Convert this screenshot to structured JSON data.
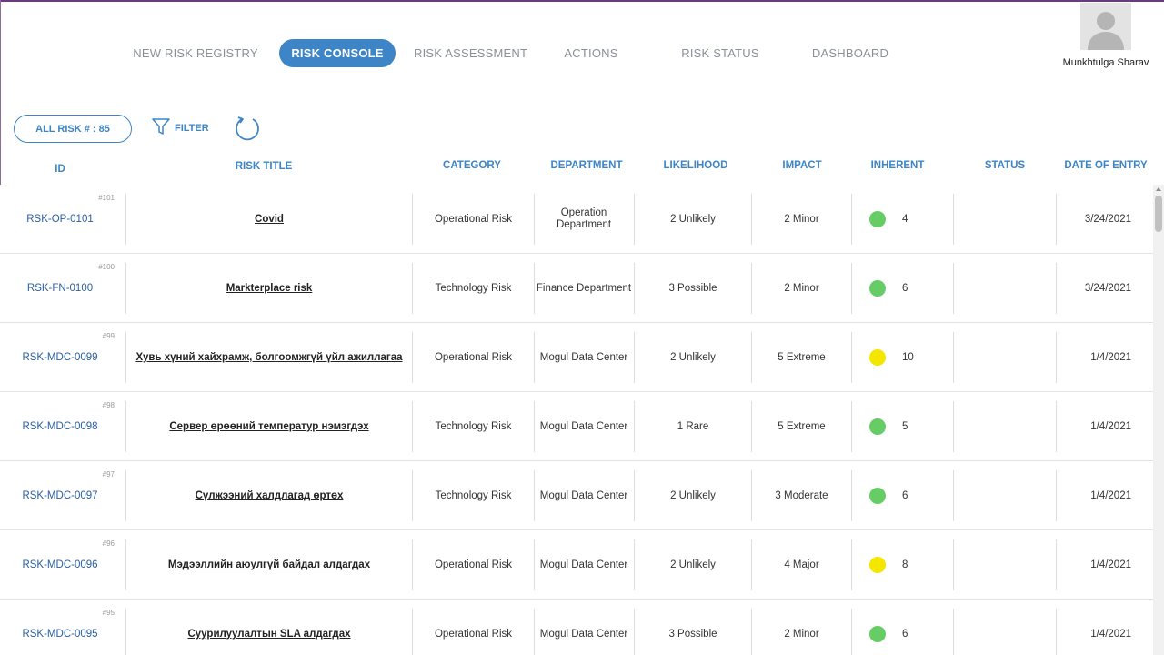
{
  "nav": {
    "items": [
      {
        "label": "NEW RISK REGISTRY",
        "active": false
      },
      {
        "label": "RISK CONSOLE",
        "active": true
      },
      {
        "label": "RISK ASSESSMENT",
        "active": false
      },
      {
        "label": "ACTIONS",
        "active": false
      },
      {
        "label": "RISK STATUS",
        "active": false
      },
      {
        "label": "DASHBOARD",
        "active": false
      }
    ]
  },
  "user": {
    "name": "Munkhtulga Sharav",
    "avatar_icon": "user-avatar-icon"
  },
  "toolbar": {
    "all_risk_label": "ALL RISK # : 85",
    "filter_label": "FILTER",
    "filter_icon": "funnel-icon",
    "refresh_icon": "refresh-icon"
  },
  "table": {
    "headers": {
      "id": "ID",
      "title": "RISK TITLE",
      "category": "CATEGORY",
      "department": "DEPARTMENT",
      "likelihood": "LIKELIHOOD",
      "impact": "IMPACT",
      "inherent": "INHERENT",
      "status": "STATUS",
      "date": "DATE OF ENTRY"
    },
    "rows": [
      {
        "seq": "#101",
        "id": "RSK-OP-0101",
        "title": "Covid",
        "category": "Operational Risk",
        "department": "Operation Department",
        "likelihood": "2 Unlikely",
        "impact": "2 Minor",
        "inherent": "4",
        "inherent_color": "#66cc66",
        "status": "",
        "date": "3/24/2021"
      },
      {
        "seq": "#100",
        "id": "RSK-FN-0100",
        "title": "Markterplace risk",
        "category": "Technology Risk",
        "department": "Finance Department",
        "likelihood": "3 Possible",
        "impact": "2 Minor",
        "inherent": "6",
        "inherent_color": "#66cc66",
        "status": "",
        "date": "3/24/2021"
      },
      {
        "seq": "#99",
        "id": "RSK-MDC-0099",
        "title": "Хувь хүний хайхрамж, болгоомжгүй үйл ажиллагаа",
        "category": "Operational Risk",
        "department": "Mogul Data Center",
        "likelihood": "2 Unlikely",
        "impact": "5 Extreme",
        "inherent": "10",
        "inherent_color": "#f5e600",
        "status": "",
        "date": "1/4/2021"
      },
      {
        "seq": "#98",
        "id": "RSK-MDC-0098",
        "title": "Сервер өрөөний температур нэмэгдэх",
        "category": "Technology Risk",
        "department": "Mogul Data Center",
        "likelihood": "1 Rare",
        "impact": "5 Extreme",
        "inherent": "5",
        "inherent_color": "#66cc66",
        "status": "",
        "date": "1/4/2021"
      },
      {
        "seq": "#97",
        "id": "RSK-MDC-0097",
        "title": "Сүлжээний халдлагад өртөх",
        "category": "Technology Risk",
        "department": "Mogul Data Center",
        "likelihood": "2 Unlikely",
        "impact": "3 Moderate",
        "inherent": "6",
        "inherent_color": "#66cc66",
        "status": "",
        "date": "1/4/2021"
      },
      {
        "seq": "#96",
        "id": "RSK-MDC-0096",
        "title": "Мэдээллийн аюулгүй байдал алдагдах",
        "category": "Operational Risk",
        "department": "Mogul Data Center",
        "likelihood": "2 Unlikely",
        "impact": "4 Major",
        "inherent": "8",
        "inherent_color": "#f5e600",
        "status": "",
        "date": "1/4/2021"
      },
      {
        "seq": "#95",
        "id": "RSK-MDC-0095",
        "title": "Суурилуулалтын SLA алдагдах",
        "category": "Operational Risk",
        "department": "Mogul Data Center",
        "likelihood": "3 Possible",
        "impact": "2 Minor",
        "inherent": "6",
        "inherent_color": "#66cc66",
        "status": "",
        "date": "1/4/2021"
      }
    ]
  }
}
